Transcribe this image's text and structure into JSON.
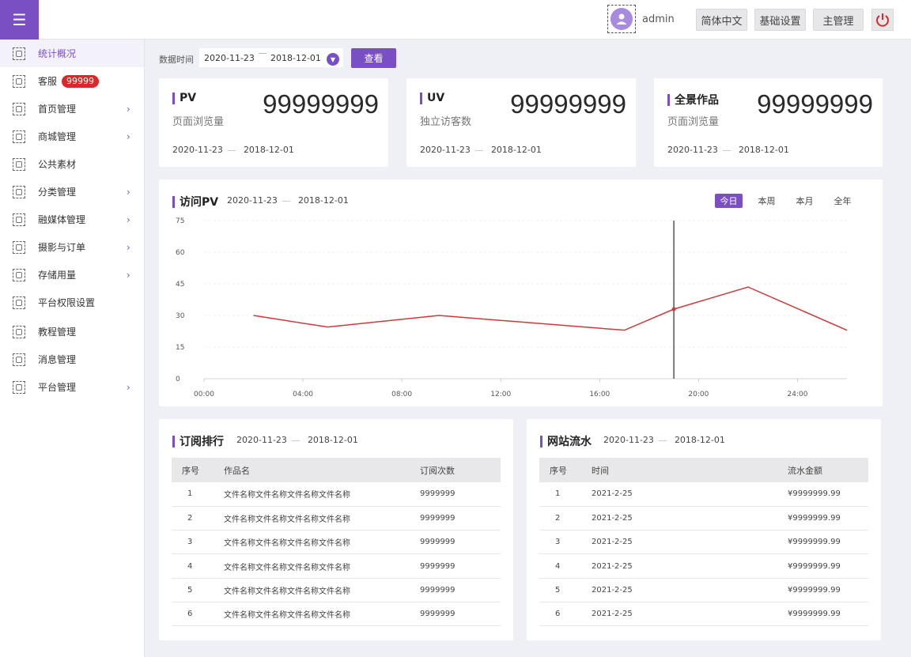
{
  "header": {
    "menu_icon": "hamburger-icon",
    "user_name": "admin",
    "buttons": [
      "简体中文",
      "基础设置",
      "主管理"
    ],
    "power_icon": "power-icon"
  },
  "sidebar": {
    "items": [
      {
        "label": "统计概况",
        "icon": "chart-icon",
        "active": true,
        "has_children": false
      },
      {
        "label": "客服",
        "icon": "headset-icon",
        "badge": "99999",
        "has_children": false
      },
      {
        "label": "首页管理",
        "icon": "home-icon",
        "has_children": true
      },
      {
        "label": "商城管理",
        "icon": "shop-icon",
        "has_children": true
      },
      {
        "label": "公共素材",
        "icon": "layers-icon",
        "has_children": false
      },
      {
        "label": "分类管理",
        "icon": "grid-icon",
        "has_children": true
      },
      {
        "label": "融媒体管理",
        "icon": "media-icon",
        "has_children": true
      },
      {
        "label": "摄影与订单",
        "icon": "camera-icon",
        "has_children": true
      },
      {
        "label": "存储用量",
        "icon": "storage-icon",
        "has_children": true
      },
      {
        "label": "平台权限设置",
        "icon": "shield-icon",
        "has_children": false
      },
      {
        "label": "教程管理",
        "icon": "monitor-icon",
        "has_children": false
      },
      {
        "label": "消息管理",
        "icon": "message-icon",
        "has_children": false
      },
      {
        "label": "平台管理",
        "icon": "platform-icon",
        "has_children": true
      }
    ]
  },
  "filter": {
    "label": "数据时间",
    "start": "2020-11-23",
    "end": "2018-12-01",
    "button": "查看"
  },
  "stats": [
    {
      "title": "PV",
      "subtitle": "页面浏览量",
      "value": "99999999",
      "start": "2020-11-23",
      "end": "2018-12-01"
    },
    {
      "title": "UV",
      "subtitle": "独立访客数",
      "value": "99999999",
      "start": "2020-11-23",
      "end": "2018-12-01"
    },
    {
      "title": "全景作品",
      "subtitle": "页面浏览量",
      "value": "99999999",
      "start": "2020-11-23",
      "end": "2018-12-01"
    }
  ],
  "pv_chart": {
    "title": "访问PV",
    "start": "2020-11-23",
    "end": "2018-12-01",
    "tabs": [
      "今日",
      "本周",
      "本月",
      "全年"
    ],
    "active_tab": "今日",
    "line_color": "#d0393a"
  },
  "chart_data": {
    "type": "line",
    "x_labels": [
      "00:00",
      "04:00",
      "08:00",
      "12:00",
      "16:00",
      "20:00",
      "24:00"
    ],
    "x_range_hours": [
      0,
      26
    ],
    "y_ticks": [
      0,
      15,
      30,
      45,
      60,
      75
    ],
    "ylim": [
      0,
      75
    ],
    "series": [
      {
        "x": [
          2,
          5,
          9.5,
          17,
          19,
          22,
          26
        ],
        "values": [
          30,
          24.5,
          30,
          23,
          33,
          43.5,
          23
        ]
      }
    ],
    "cursor_x": 19,
    "grid": true
  },
  "subscription": {
    "title": "订阅排行",
    "start": "2020-11-23",
    "end": "2018-12-01",
    "columns": [
      "序号",
      "作品名",
      "订阅次数"
    ],
    "rows": [
      [
        "1",
        "文件名称文件名称文件名称文件名称",
        "9999999"
      ],
      [
        "2",
        "文件名称文件名称文件名称文件名称",
        "9999999"
      ],
      [
        "3",
        "文件名称文件名称文件名称文件名称",
        "9999999"
      ],
      [
        "4",
        "文件名称文件名称文件名称文件名称",
        "9999999"
      ],
      [
        "5",
        "文件名称文件名称文件名称文件名称",
        "9999999"
      ],
      [
        "6",
        "文件名称文件名称文件名称文件名称",
        "9999999"
      ]
    ]
  },
  "revenue": {
    "title": "网站流水",
    "start": "2020-11-23",
    "end": "2018-12-01",
    "columns": [
      "序号",
      "时间",
      "流水金额"
    ],
    "rows": [
      [
        "1",
        "2021-2-25",
        "¥9999999.99"
      ],
      [
        "2",
        "2021-2-25",
        "¥9999999.99"
      ],
      [
        "3",
        "2021-2-25",
        "¥9999999.99"
      ],
      [
        "4",
        "2021-2-25",
        "¥9999999.99"
      ],
      [
        "5",
        "2021-2-25",
        "¥9999999.99"
      ],
      [
        "6",
        "2021-2-25",
        "¥9999999.99"
      ]
    ]
  }
}
